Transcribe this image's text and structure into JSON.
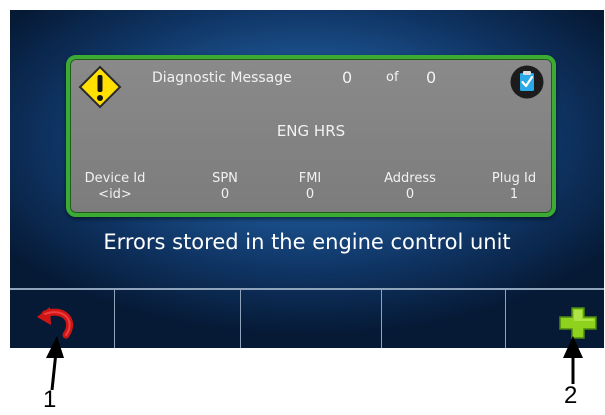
{
  "panel": {
    "title": "Diagnostic Message",
    "current": "0",
    "of_label": "of",
    "total": "0",
    "message": "ENG HRS",
    "columns": [
      {
        "label": "Device Id",
        "value": "<id>"
      },
      {
        "label": "SPN",
        "value": "0"
      },
      {
        "label": "FMI",
        "value": "0"
      },
      {
        "label": "Address",
        "value": "0"
      },
      {
        "label": "Plug Id",
        "value": "1"
      }
    ],
    "icons": {
      "left": "warning-icon",
      "right": "clipboard-check-icon"
    }
  },
  "status_text": "Errors stored in the engine control unit",
  "softkeys": {
    "back": "back-arrow-icon",
    "add": "plus-icon"
  },
  "callouts": {
    "one": "1",
    "two": "2"
  },
  "colors": {
    "panel_border": "#3cab34",
    "panel_bg": "#808080",
    "screen_bg": "#1d5593"
  }
}
